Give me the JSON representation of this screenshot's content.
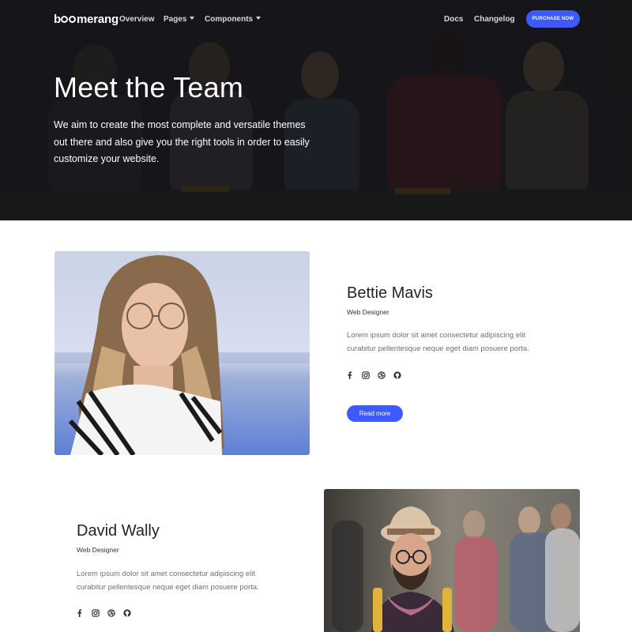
{
  "nav": {
    "brand": "boomerang",
    "overview": "Overview",
    "pages": "Pages",
    "components": "Components",
    "docs": "Docs",
    "changelog": "Changelog",
    "purchase": "PURCHASE NOW"
  },
  "hero": {
    "title": "Meet the Team",
    "text": "We aim to create the most complete and versatile themes out there and also give you the right tools in order to easily customize your website."
  },
  "members": [
    {
      "name": "Bettie Mavis",
      "role": "Web Designer",
      "bio": "Lorem ipsum dolor sit amet consectetur adipiscing elit curabitur pellentesque neque eget diam posuere porta.",
      "read_more": "Read more",
      "socials": [
        "facebook-icon",
        "instagram-icon",
        "dribbble-icon",
        "github-icon"
      ]
    },
    {
      "name": "David Wally",
      "role": "Web Designer",
      "bio": "Lorem ipsum dolor sit amet consectetur adipiscing elit curabitur pellentesque neque eget diam posuere porta.",
      "socials": [
        "facebook-icon",
        "instagram-icon",
        "dribbble-icon",
        "github-icon"
      ]
    }
  ],
  "colors": {
    "accent": "#3d5afe",
    "hero_dark": "#1f1f22"
  }
}
